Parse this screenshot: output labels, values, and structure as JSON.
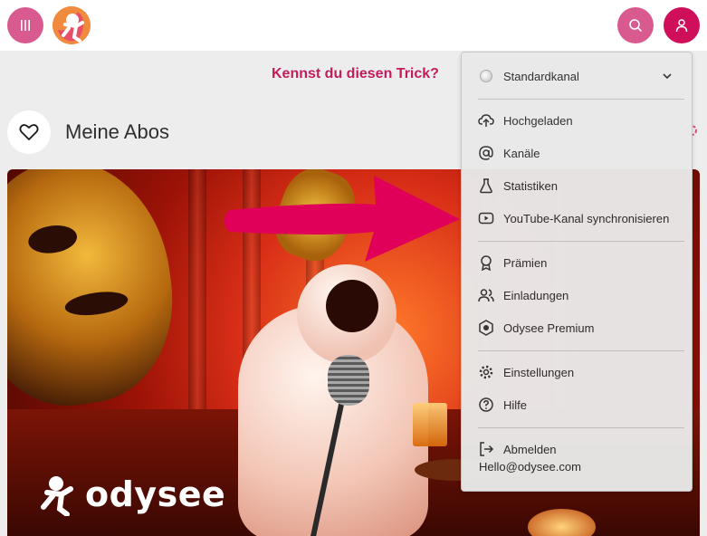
{
  "header": {
    "menu_icon": "menu-bars-icon",
    "logo_icon": "odysee-logo-icon",
    "search_icon": "search-icon",
    "account_icon": "user-icon"
  },
  "banner": {
    "tip_text": "Kennst du diesen Trick?"
  },
  "subscriptions": {
    "title": "Meine Abos",
    "icon": "heart-icon"
  },
  "hero": {
    "watermark_text": "odysee"
  },
  "account_menu": {
    "channel_selector": "Standardkanal",
    "groups": [
      [
        {
          "label": "Hochgeladen",
          "icon": "upload-cloud-icon"
        },
        {
          "label": "Kanäle",
          "icon": "at-sign-icon"
        },
        {
          "label": "Statistiken",
          "icon": "flask-icon"
        },
        {
          "label": "YouTube-Kanal synchronisieren",
          "icon": "youtube-icon"
        }
      ],
      [
        {
          "label": "Prämien",
          "icon": "award-icon"
        },
        {
          "label": "Einladungen",
          "icon": "users-icon"
        },
        {
          "label": "Odysee Premium",
          "icon": "premium-badge-icon"
        }
      ],
      [
        {
          "label": "Einstellungen",
          "icon": "gear-icon"
        },
        {
          "label": "Hilfe",
          "icon": "help-circle-icon"
        }
      ]
    ],
    "logout_label": "Abmelden",
    "email": "Hello@odysee.com"
  },
  "colors": {
    "brand": "#cf0f5a",
    "brand_light": "#d85a8e",
    "tip_text": "#c31c5d"
  }
}
